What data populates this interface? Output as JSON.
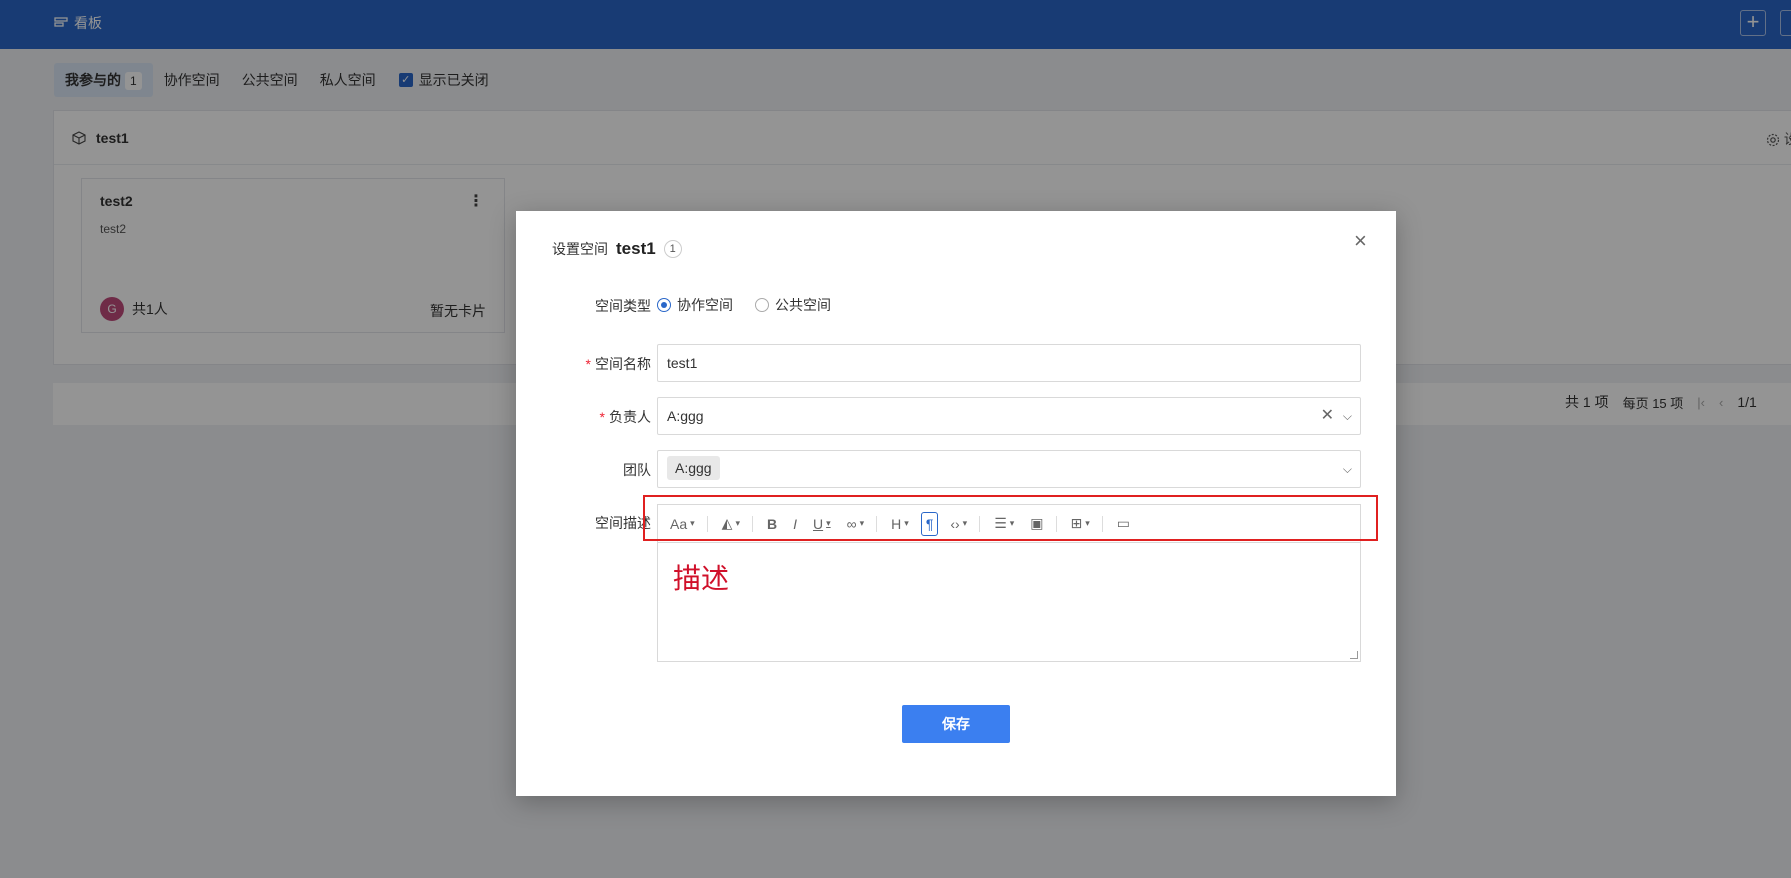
{
  "topbar": {
    "title": "看板",
    "add_label": "+"
  },
  "tabs": {
    "items": [
      {
        "label": "我参与的",
        "badge": "1"
      },
      {
        "label": "协作空间"
      },
      {
        "label": "公共空间"
      },
      {
        "label": "私人空间"
      }
    ],
    "show_closed_label": "显示已关闭",
    "show_closed_checked": true
  },
  "space": {
    "name": "test1",
    "settings_label": "设"
  },
  "card": {
    "title": "test2",
    "description": "test2",
    "avatar_initial": "G",
    "members": "共1人",
    "cards_status": "暂无卡片"
  },
  "pager": {
    "total": "共 1 项",
    "per_page": "每页 15 项",
    "page": "1/1"
  },
  "modal": {
    "header_label": "设置空间",
    "space_name": "test1",
    "count": "1",
    "close_label": "×",
    "type": {
      "label": "空间类型",
      "options": [
        "协作空间",
        "公共空间"
      ],
      "selected": "协作空间"
    },
    "name_field": {
      "label": "空间名称",
      "value": "test1"
    },
    "owner_field": {
      "label": "负责人",
      "value": "A:ggg"
    },
    "team_field": {
      "label": "团队",
      "tag": "A:ggg"
    },
    "description": {
      "label": "空间描述",
      "placeholder": "描述"
    },
    "save_label": "保存"
  },
  "colors": {
    "topbar": "#2a67c9",
    "primary_button": "#3b7ff0",
    "highlight_box": "#e02020",
    "placeholder_text": "#d0102a",
    "avatar": "#c04a7b"
  }
}
